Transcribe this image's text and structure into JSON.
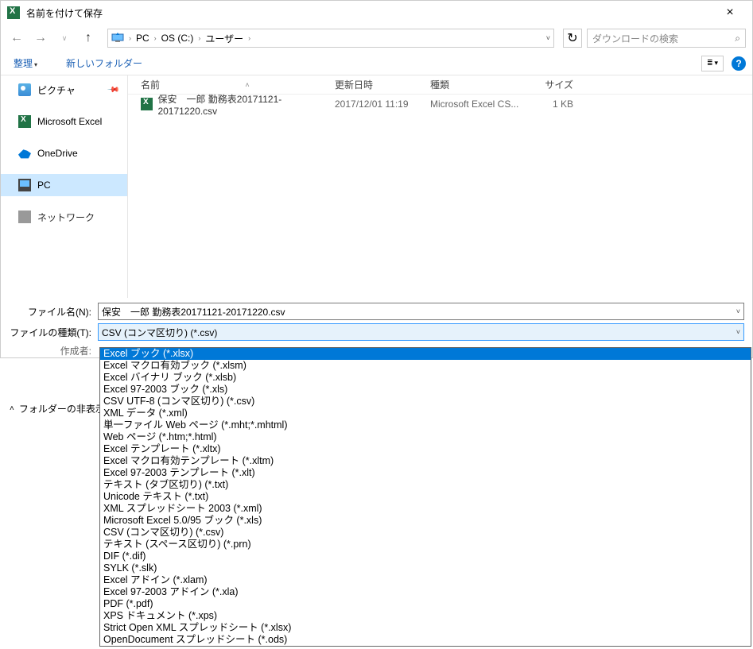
{
  "titlebar": {
    "title": "名前を付けて保存",
    "close": "×"
  },
  "nav": {
    "path_segments": [
      "PC",
      "OS (C:)",
      "ユーザー"
    ],
    "refresh_icon": "↻",
    "search_placeholder": "ダウンロードの検索"
  },
  "toolbar": {
    "organize": "整理",
    "newfolder": "新しいフォルダー"
  },
  "sidebar": {
    "items": [
      {
        "label": "ピクチャ",
        "pinned": true
      },
      {
        "label": "Microsoft Excel"
      },
      {
        "label": "OneDrive"
      },
      {
        "label": "PC",
        "selected": true
      },
      {
        "label": "ネットワーク"
      }
    ]
  },
  "columns": {
    "name": "名前",
    "date": "更新日時",
    "kind": "種類",
    "size": "サイズ"
  },
  "rows": [
    {
      "name": "保安　一郎 勤務表20171121-20171220.csv",
      "date": "2017/12/01 11:19",
      "kind": "Microsoft Excel CS...",
      "size": "1 KB"
    }
  ],
  "form": {
    "filename_label": "ファイル名(N):",
    "filename_value": "保安　一郎 勤務表20171121-20171220.csv",
    "filetype_label": "ファイルの種類(T):",
    "filetype_value": "CSV (コンマ区切り) (*.csv)",
    "author_label": "作成者:"
  },
  "folders_toggle": "フォルダーの非表示",
  "options": [
    "Excel ブック (*.xlsx)",
    "Excel マクロ有効ブック (*.xlsm)",
    "Excel バイナリ ブック (*.xlsb)",
    "Excel 97-2003 ブック (*.xls)",
    "CSV UTF-8 (コンマ区切り) (*.csv)",
    "XML データ (*.xml)",
    "単一ファイル Web ページ (*.mht;*.mhtml)",
    "Web ページ (*.htm;*.html)",
    "Excel テンプレート (*.xltx)",
    "Excel マクロ有効テンプレート (*.xltm)",
    "Excel 97-2003 テンプレート (*.xlt)",
    "テキスト (タブ区切り) (*.txt)",
    "Unicode テキスト (*.txt)",
    "XML スプレッドシート 2003 (*.xml)",
    "Microsoft Excel 5.0/95 ブック (*.xls)",
    "CSV (コンマ区切り) (*.csv)",
    "テキスト (スペース区切り) (*.prn)",
    "DIF (*.dif)",
    "SYLK (*.slk)",
    "Excel アドイン (*.xlam)",
    "Excel 97-2003 アドイン (*.xla)",
    "PDF (*.pdf)",
    "XPS ドキュメント (*.xps)",
    "Strict Open XML スプレッドシート (*.xlsx)",
    "OpenDocument スプレッドシート (*.ods)"
  ],
  "selected_option_index": 0
}
